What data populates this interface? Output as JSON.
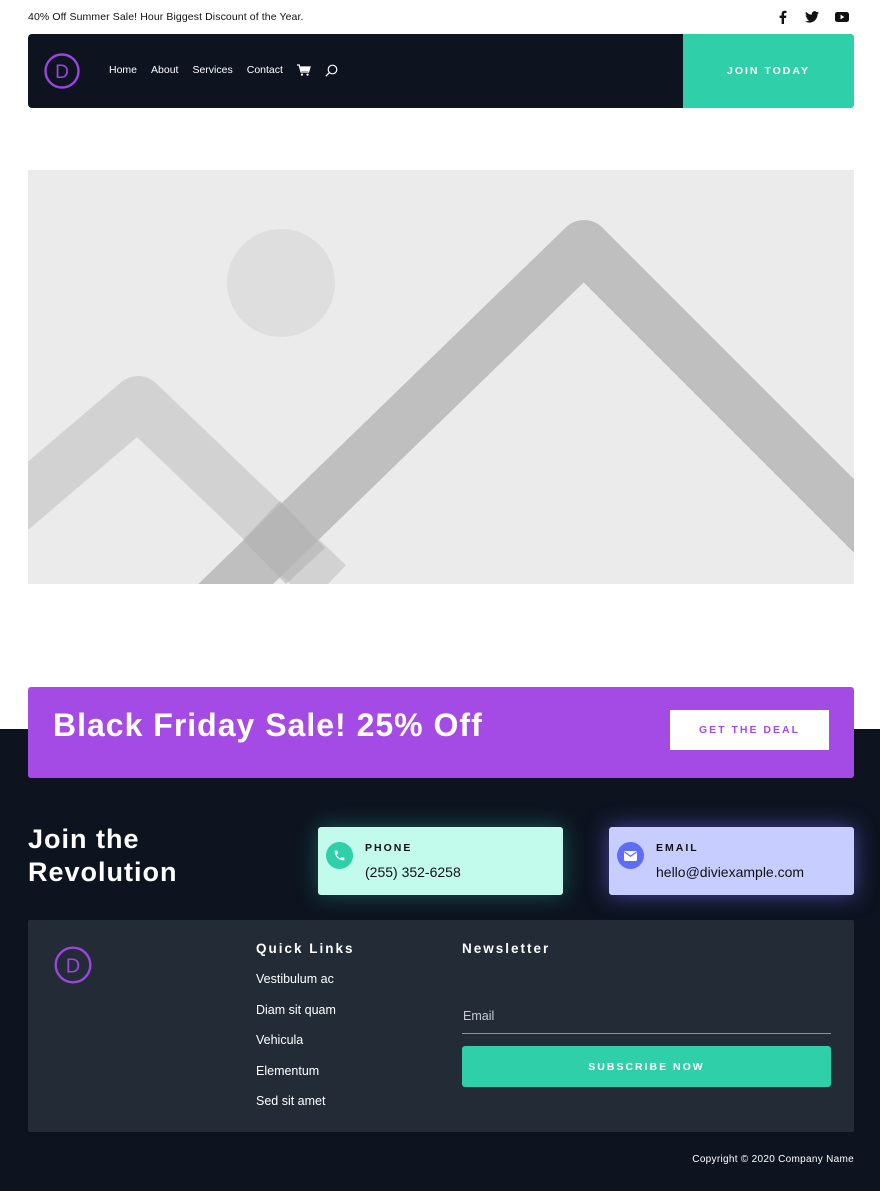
{
  "topbar": {
    "promo_text": "40% Off Summer Sale! Hour Biggest Discount of the Year.",
    "social_icons": [
      "facebook-icon",
      "twitter-icon",
      "youtube-icon"
    ]
  },
  "nav": {
    "logo_letter": "D",
    "links": [
      "Home",
      "About",
      "Services",
      "Contact"
    ],
    "icons": [
      "cart-icon",
      "search-icon"
    ],
    "cta_label": "JOIN TODAY"
  },
  "hero": {
    "image_icon": "image-placeholder-icon"
  },
  "banner": {
    "title": "Black Friday Sale! 25% Off",
    "button_label": "GET THE DEAL"
  },
  "contact": {
    "heading_line1": "Join the",
    "heading_line2": "Revolution",
    "phone_label": "PHONE",
    "phone_value": "(255) 352-6258",
    "email_label": "EMAIL",
    "email_value": "hello@diviexample.com"
  },
  "footer": {
    "quick_links_title": "Quick Links",
    "quick_links": [
      "Vestibulum ac",
      "Diam sit quam",
      "Vehicula",
      "Elementum",
      "Sed sit amet"
    ],
    "newsletter_title": "Newsletter",
    "email_placeholder": "Email",
    "subscribe_label": "SUBSCRIBE NOW",
    "copyright": "Copyright © 2020 Company Name"
  },
  "colors": {
    "nav_bg": "#0d1420",
    "accent_teal": "#2ecfa9",
    "accent_purple": "#a44be6",
    "footer_box": "#222b36"
  }
}
